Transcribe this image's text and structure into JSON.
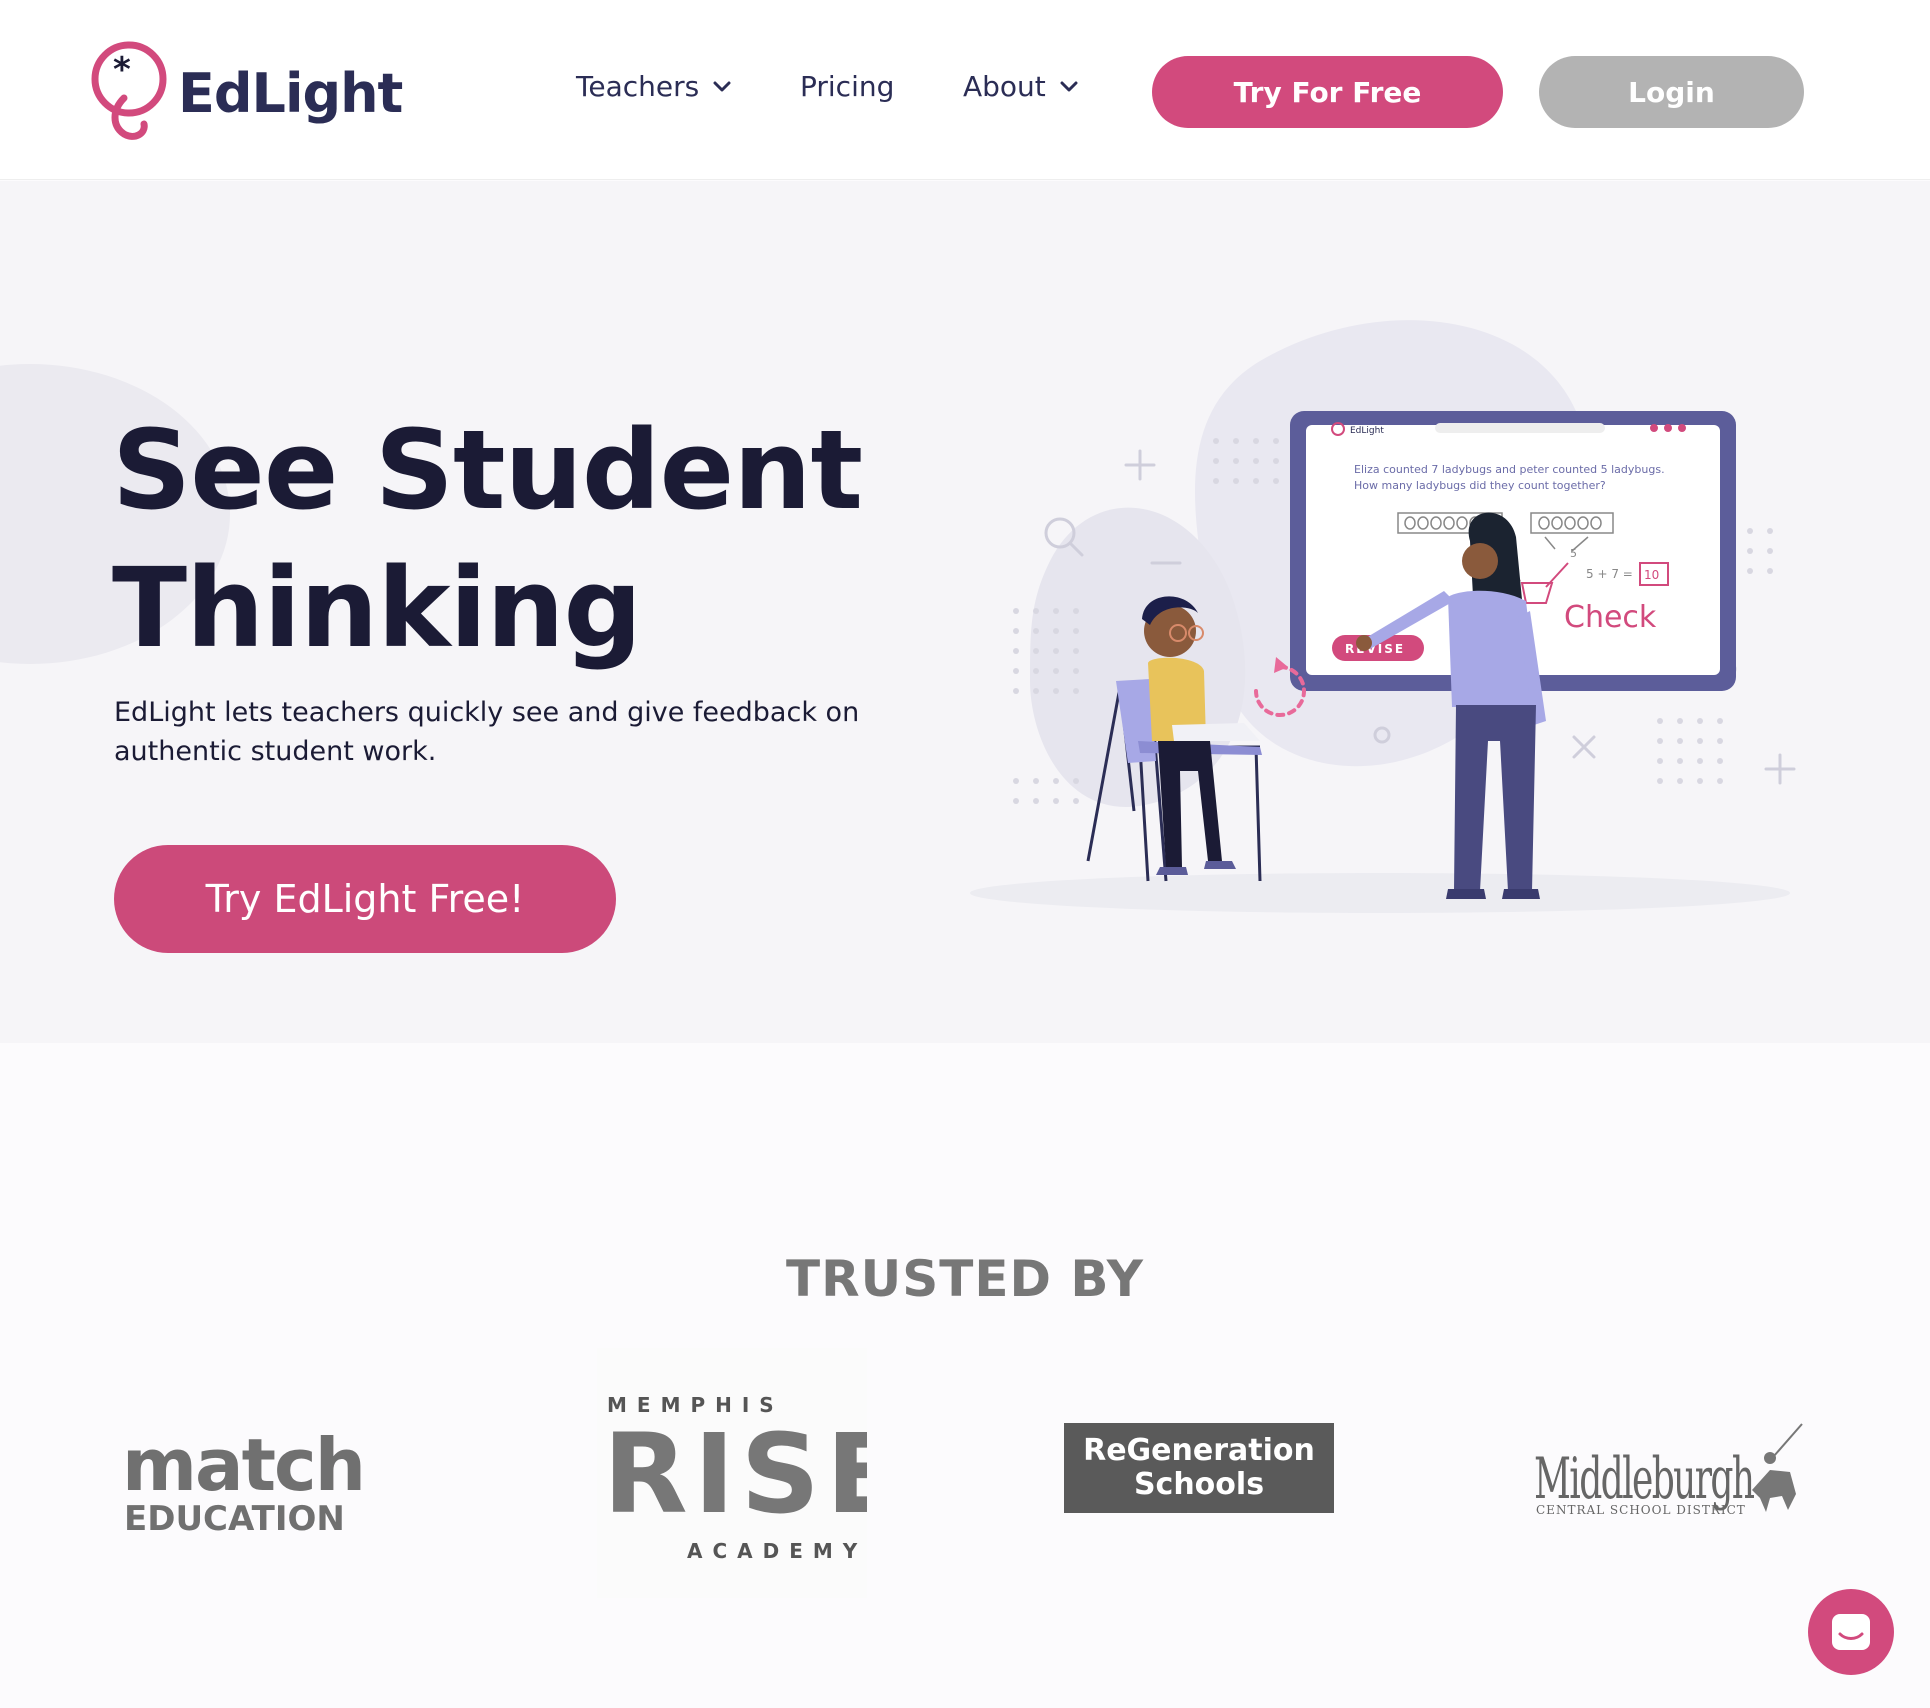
{
  "header": {
    "brand": "EdLight",
    "nav": {
      "teachers": "Teachers",
      "pricing": "Pricing",
      "about": "About"
    },
    "try_button": "Try For Free",
    "login_button": "Login"
  },
  "hero": {
    "title_line1": "See Student",
    "title_line2": "Thinking",
    "subtitle": "EdLight lets teachers quickly see and give feedback on authentic student work.",
    "cta": "Try EdLight Free!",
    "illustration": {
      "screen_brand": "EdLight",
      "problem_text_1": "Eliza counted 7 ladybugs and peter counted 5 ladybugs.",
      "problem_text_2": "How many ladybugs did they count together?",
      "equation": "5 + 7 =",
      "answer": "10",
      "five": "5",
      "check_word": "Check",
      "revise_button": "REVISE"
    }
  },
  "trusted": {
    "title": "TRUSTED BY",
    "logos": {
      "match_line1": "match",
      "match_line2": "EDUCATION",
      "rise_top": "MEMPHIS",
      "rise_main": "RISE",
      "rise_bottom": "ACADEMY",
      "regen_line1": "ReGeneration",
      "regen_line2": "Schools",
      "middleburgh_main": "Middleburgh",
      "middleburgh_sub": "CENTRAL SCHOOL DISTRICT"
    }
  },
  "colors": {
    "brand_pink": "#d24a7d",
    "navy": "#2b2d55",
    "grey_button": "#b3b3b3"
  },
  "icons": [
    "edlight-logo-icon",
    "chevron-down-icon",
    "chat-icon",
    "refresh-icon"
  ]
}
